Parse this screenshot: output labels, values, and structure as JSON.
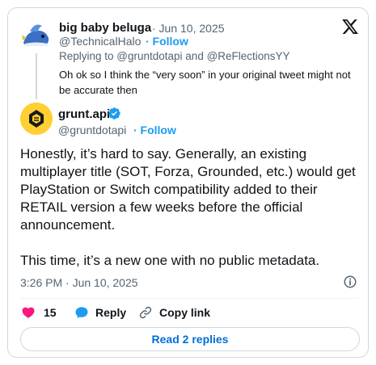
{
  "parent_tweet": {
    "author_name": "big baby beluga",
    "date": "· Jun 10, 2025",
    "handle": "@TechnicalHalo",
    "follow_label": "· Follow",
    "replying_to": "Replying to @gruntdotapi and @ReFlectionsYY",
    "text": "Oh ok so I think the “very soon” in your original tweet might not be accurate then"
  },
  "main_tweet": {
    "author_name": "grunt.api",
    "handle": "@gruntdotapi",
    "follow_label": "· Follow",
    "paragraph_1": "Honestly, it’s hard to say. Generally, an existing multiplayer title (SOT, Forza, Grounded, etc.) would get PlayStation or Switch compatibility added to their RETAIL version a few weeks before the official announcement.",
    "paragraph_2": "This time, it’s a new one with no public metadata.",
    "timestamp": "3:26 PM · Jun 10, 2025"
  },
  "actions": {
    "like_count": "15",
    "reply_label": "Reply",
    "copy_link_label": "Copy link"
  },
  "read_replies_label": "Read 2 replies",
  "icons": {
    "platform": "x-logo-icon",
    "verified": "verified-badge-icon",
    "info": "info-icon",
    "like": "heart-icon",
    "reply": "speech-bubble-icon",
    "copy": "link-icon"
  },
  "colors": {
    "accent": "#1d9bf0",
    "like": "#f91880",
    "link_button_text": "#006fd6",
    "muted_text": "#536471"
  }
}
